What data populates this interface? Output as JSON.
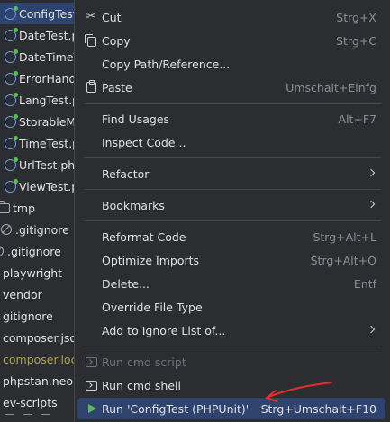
{
  "tree": {
    "items": [
      {
        "label": "ConfigTest",
        "icon": "php-class-icon",
        "selected": true
      },
      {
        "label": "DateTest.p",
        "icon": "php-class-icon"
      },
      {
        "label": "DateTimeT",
        "icon": "php-class-icon"
      },
      {
        "label": "ErrorHand",
        "icon": "php-class-icon"
      },
      {
        "label": "LangTest.p",
        "icon": "php-class-icon"
      },
      {
        "label": "StorableM",
        "icon": "php-class-icon"
      },
      {
        "label": "TimeTest.p",
        "icon": "php-class-icon"
      },
      {
        "label": "UrlTest.ph",
        "icon": "php-class-icon"
      },
      {
        "label": "ViewTest.p",
        "icon": "php-class-icon"
      },
      {
        "label": "tmp",
        "icon": "folder-icon"
      },
      {
        "label": ".gitignore",
        "icon": "ignore-file-icon"
      },
      {
        "label": ".gitignore",
        "icon": "ignore-file-icon"
      },
      {
        "label": "playwright",
        "icon": "folder-icon"
      },
      {
        "label": "vendor",
        "icon": "folder-icon"
      },
      {
        "label": "gitignore",
        "icon": "ignore-file-icon"
      },
      {
        "label": "composer.json",
        "icon": "json-file-icon"
      },
      {
        "label": "composer.lock",
        "icon": "lock-file-icon",
        "color": "#b0a24e"
      },
      {
        "label": "phpstan.neon",
        "icon": "neon-file-icon"
      },
      {
        "label": "ev-scripts",
        "icon": "folder-icon"
      }
    ]
  },
  "menu": {
    "cut": {
      "label": "Cut",
      "shortcut": "Strg+X"
    },
    "copy": {
      "label": "Copy",
      "shortcut": "Strg+C"
    },
    "copy_path": {
      "label": "Copy Path/Reference..."
    },
    "paste": {
      "label": "Paste",
      "shortcut": "Umschalt+Einfg"
    },
    "find_usages": {
      "label": "Find Usages",
      "shortcut": "Alt+F7"
    },
    "inspect_code": {
      "label": "Inspect Code..."
    },
    "refactor": {
      "label": "Refactor"
    },
    "bookmarks": {
      "label": "Bookmarks"
    },
    "reformat_code": {
      "label": "Reformat Code",
      "shortcut": "Strg+Alt+L"
    },
    "optimize_imports": {
      "label": "Optimize Imports",
      "shortcut": "Strg+Alt+O"
    },
    "delete": {
      "label": "Delete...",
      "shortcut": "Entf"
    },
    "override_file_type": {
      "label": "Override File Type"
    },
    "add_to_ignore": {
      "label": "Add to Ignore List of..."
    },
    "run_cmd_script": {
      "label": "Run cmd script"
    },
    "run_cmd_shell": {
      "label": "Run cmd shell"
    },
    "run_config": {
      "label": "Run 'ConfigTest (PHPUnit)'",
      "shortcut": "Strg+Umschalt+F10"
    }
  },
  "colors": {
    "background": "#2b2d30",
    "highlight": "#2e436e",
    "separator": "#43454a",
    "annotation_arrow": "#e0302a",
    "run_icon": "#5fb85f"
  }
}
